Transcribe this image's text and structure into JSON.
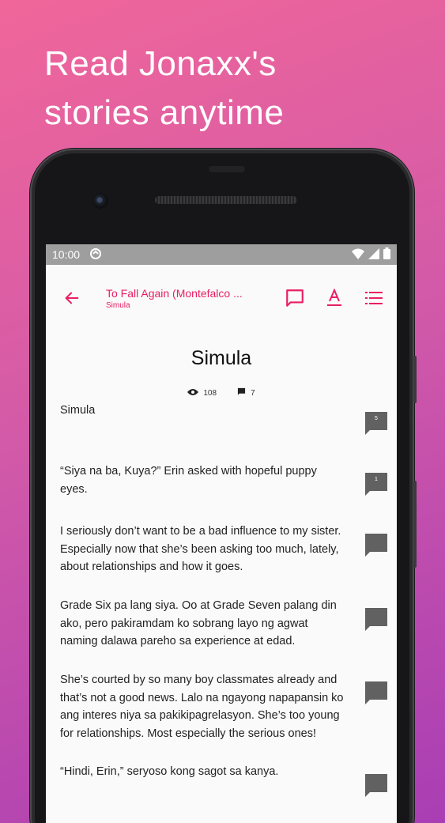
{
  "promo": {
    "line1": "Read Jonaxx's",
    "line2": "stories anytime"
  },
  "statusbar": {
    "time": "10:00"
  },
  "appbar": {
    "back_icon": "arrow-left-icon",
    "story_title": "To Fall Again (Montefalco ...",
    "chapter_subtitle": "Simula",
    "actions": [
      "comment-icon",
      "text-format-icon",
      "chapter-list-icon"
    ]
  },
  "chapter": {
    "title": "Simula",
    "views": "108",
    "comments": "7"
  },
  "paragraphs": [
    {
      "text": "Simula",
      "comment_count": "5"
    },
    {
      "text": "“Siya na ba, Kuya?” Erin asked with hopeful puppy eyes.",
      "comment_count": "1"
    },
    {
      "text": "I seriously don’t want to be a bad influence to my sister. Especially now that she’s been asking too much, lately, about relationships and how it goes.",
      "comment_count": ""
    },
    {
      "text": "Grade Six pa lang siya. Oo at Grade Seven palang din ako, pero pakiramdam ko sobrang layo ng agwat naming dalawa pareho sa experience at edad.",
      "comment_count": ""
    },
    {
      "text": "She’s courted by so many boy classmates already and that’s not a good news. Lalo na ngayong napapansin ko ang interes niya sa pakikipagrelasyon. She’s too young for relationships. Most especially the serious ones!",
      "comment_count": ""
    },
    {
      "text": "“Hindi, Erin,” seryoso kong sagot sa kanya.",
      "comment_count": ""
    }
  ],
  "colors": {
    "accent": "#e91e63",
    "comment_bubble": "#616161",
    "statusbar": "#9e9e9e"
  }
}
